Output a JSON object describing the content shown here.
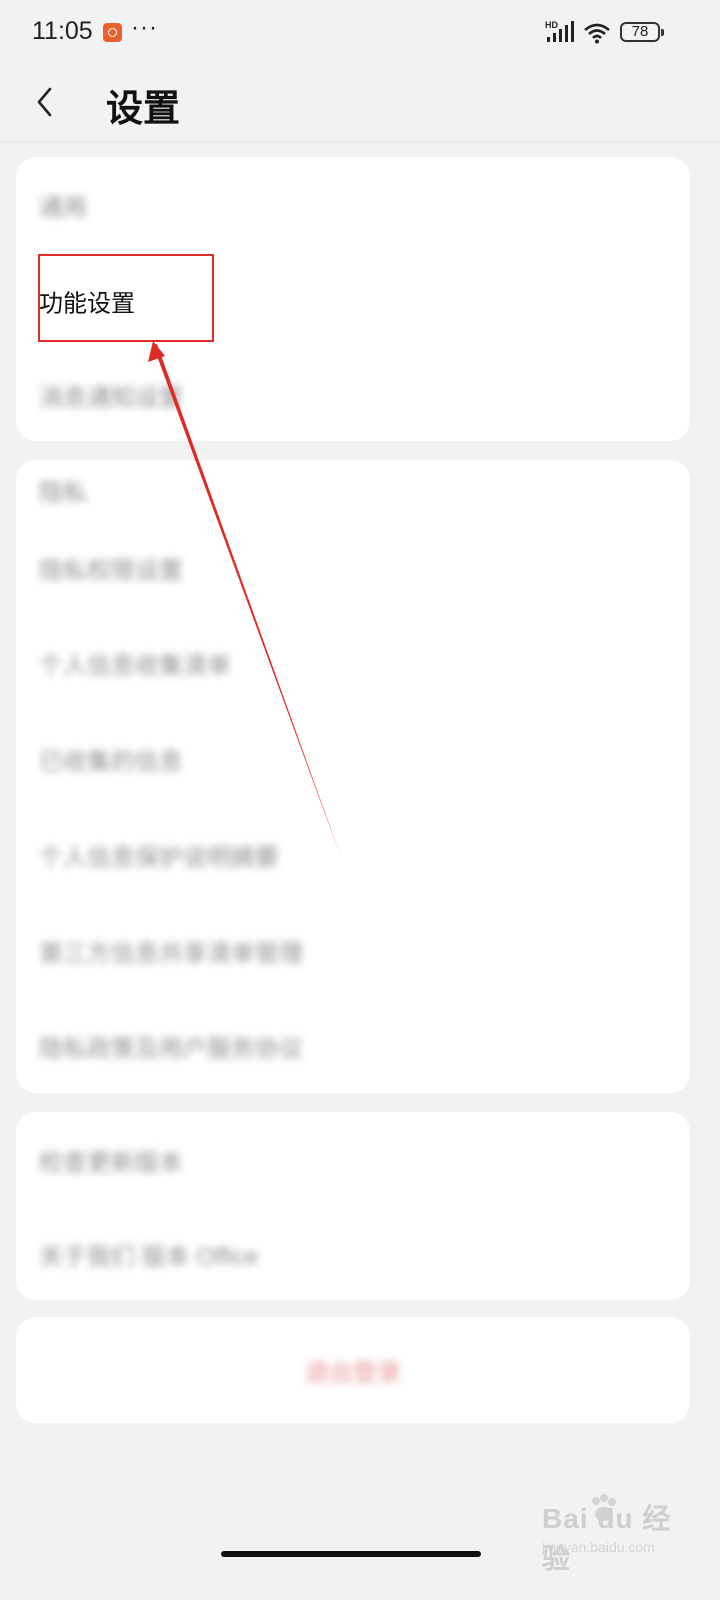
{
  "status_bar": {
    "time": "11:05",
    "more": "···",
    "network_label": "HD",
    "battery": "78",
    "notification_icon": "app-notification-icon",
    "signal_icon": "signal-icon",
    "wifi_icon": "wifi-icon",
    "battery_icon": "battery-icon"
  },
  "header": {
    "title": "设置",
    "back_icon": "chevron-left-icon"
  },
  "groups": [
    {
      "items": [
        {
          "label": "通用"
        },
        {
          "label": "功能设置",
          "highlighted": true
        },
        {
          "label": "消息通知设置"
        }
      ]
    },
    {
      "items": [
        {
          "label": "隐私"
        },
        {
          "label": "隐私权限设置"
        },
        {
          "label": "个人信息收集清单"
        },
        {
          "label": "已收集的信息"
        },
        {
          "label": "个人信息保护说明摘要"
        },
        {
          "label": "第三方信息共享清单管理"
        },
        {
          "label": "隐私政策及用户服务协议"
        }
      ]
    },
    {
      "items": [
        {
          "label": "检查更新版本"
        },
        {
          "label": "关于我们 版本 Office"
        }
      ]
    }
  ],
  "logout": {
    "label": "退出登录"
  },
  "watermark": {
    "brand": "Bai du 经验",
    "url": "jingyan.baidu.com"
  },
  "colors": {
    "annotation_red": "#e02a24",
    "background": "#f1f2f4",
    "card": "#ffffff"
  }
}
